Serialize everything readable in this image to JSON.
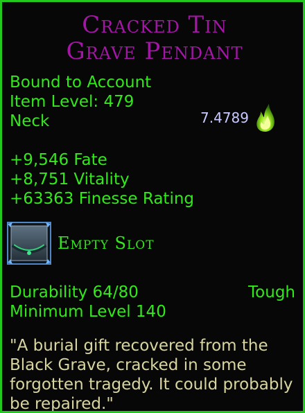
{
  "item": {
    "name_line1": "Cracked Tin",
    "name_line2": "Grave Pendant",
    "binding": "Bound to Account",
    "item_level": "Item Level: 479",
    "slot_type": "Neck",
    "value": "7.4789",
    "value_icon": "green-flame-icon",
    "stats": [
      "+9,546 Fate",
      "+8,751 Vitality",
      "+63363 Finesse Rating"
    ],
    "essence_slot": {
      "label": "Empty Slot",
      "icon": "empty-essence-slot-icon"
    },
    "durability": "Durability 64/80",
    "durability_type": "Tough",
    "min_level": "Minimum Level 140",
    "flavor": "\"A burial gift recovered from the Black Grave, cracked in some forgotten tragedy. It could probably be repaired.\""
  },
  "colors": {
    "border": "#23c81e",
    "name": "#a316a6",
    "stat_text": "#33e81b",
    "value_text": "#c9cbff",
    "flavor_text": "#d8d5a1"
  }
}
